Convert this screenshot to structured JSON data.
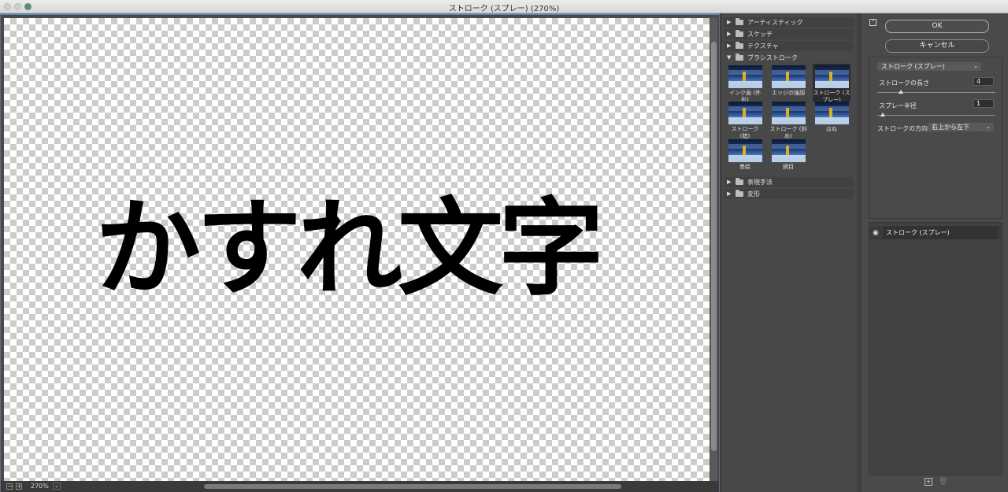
{
  "window": {
    "title": "ストローク (スプレー) (270%)"
  },
  "canvas": {
    "text": "かすれ文字",
    "zoom": "270%"
  },
  "gallery": {
    "categories_top": [
      {
        "label": "アーティスティック",
        "expanded": false
      },
      {
        "label": "スケッチ",
        "expanded": false
      },
      {
        "label": "テクスチャ",
        "expanded": false
      },
      {
        "label": "ブラシストローク",
        "expanded": true
      }
    ],
    "thumbnails": [
      {
        "label": "インク画 (外形)",
        "selected": false
      },
      {
        "label": "エッジの強調",
        "selected": false
      },
      {
        "label": "ストローク (スプレー)",
        "selected": true
      },
      {
        "label": "ストローク (暗)",
        "selected": false
      },
      {
        "label": "ストローク (斜め)",
        "selected": false
      },
      {
        "label": "はね",
        "selected": false
      },
      {
        "label": "墨絵",
        "selected": false
      },
      {
        "label": "網目",
        "selected": false
      }
    ],
    "categories_bottom": [
      {
        "label": "表現手法",
        "expanded": false
      },
      {
        "label": "変形",
        "expanded": false
      }
    ]
  },
  "panel": {
    "ok_label": "OK",
    "cancel_label": "キャンセル",
    "filter_select": "ストローク (スプレー)",
    "params": [
      {
        "label": "ストロークの長さ",
        "value": "4"
      },
      {
        "label": "スプレー半径",
        "value": "1"
      }
    ],
    "direction_label": "ストロークの方向：",
    "direction_value": "右上から左下",
    "layer_name": "ストローク (スプレー)"
  },
  "icons": {
    "expanded_arrow": "▼",
    "collapsed_arrow": "▶",
    "chevron_down": "⌄",
    "eye": "◉"
  },
  "colors": {
    "panel_bg": "#484848",
    "selected_thumb_bg": "#2c2c2c",
    "canvas_frame_accent": "#5f86b3"
  }
}
